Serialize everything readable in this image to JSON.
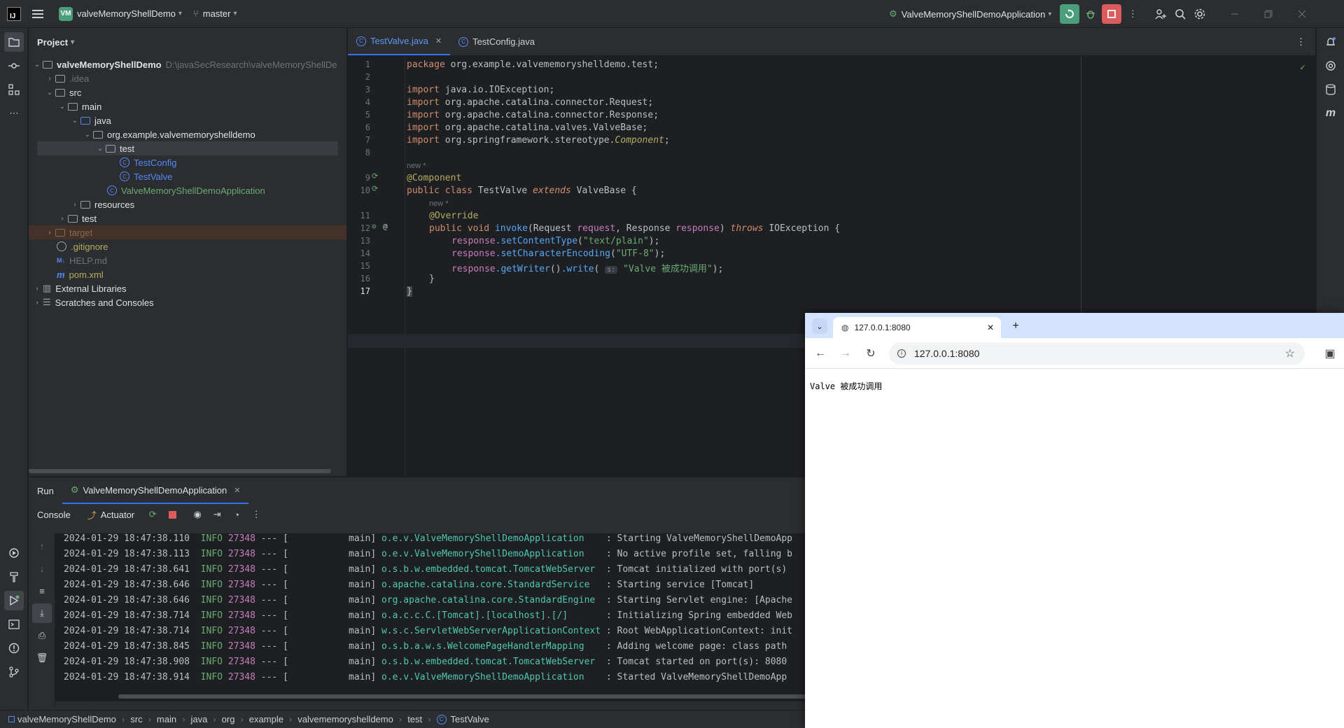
{
  "titlebar": {
    "project_badge": "VM",
    "project_name": "valveMemoryShellDemo",
    "branch": "master",
    "run_config": "ValveMemoryShellDemoApplication"
  },
  "project_panel": {
    "title": "Project",
    "root_name": "valveMemoryShellDemo",
    "root_path": "D:\\javaSecResearch\\valveMemoryShellDe",
    "items": [
      {
        "label": ".idea"
      },
      {
        "label": "src"
      },
      {
        "label": "main"
      },
      {
        "label": "java"
      },
      {
        "label": "org.example.valvememoryshelldemo"
      },
      {
        "label": "test"
      },
      {
        "label": "TestConfig"
      },
      {
        "label": "TestValve"
      },
      {
        "label": "ValveMemoryShellDemoApplication"
      },
      {
        "label": "resources"
      },
      {
        "label": "test"
      },
      {
        "label": "target"
      },
      {
        "label": ".gitignore"
      },
      {
        "label": "HELP.md"
      },
      {
        "label": "pom.xml"
      },
      {
        "label": "External Libraries"
      },
      {
        "label": "Scratches and Consoles"
      }
    ]
  },
  "editor": {
    "tabs": [
      {
        "label": "TestValve.java"
      },
      {
        "label": "TestConfig.java"
      }
    ],
    "line_numbers": [
      "1",
      "2",
      "3",
      "4",
      "5",
      "6",
      "7",
      "8",
      "9",
      "10",
      "11",
      "12",
      "13",
      "14",
      "15",
      "16",
      "17"
    ],
    "code": {
      "l1_kw": "package",
      "l1_rest": " org.example.valvememoryshelldemo.test;",
      "l3_kw": "import",
      "l3_rest": " java.io.IOException;",
      "l4_kw": "import",
      "l4_rest": " org.apache.catalina.connector.Request;",
      "l5_kw": "import",
      "l5_rest": " org.apache.catalina.connector.Response;",
      "l6_kw": "import",
      "l6_rest": " org.apache.catalina.valves.ValveBase;",
      "l7_kw": "import",
      "l7_rest_a": " org.springframework.stereotype.",
      "l7_rest_b": "Component",
      "l7_rest_c": ";",
      "hint_new": "new *",
      "l9": "@Component",
      "l10_public": "public",
      "l10_class": " class ",
      "l10_name": "TestValve ",
      "l10_extends": "extends",
      "l10_base": " ValveBase {",
      "l11": "@Override",
      "l12_public": "public",
      "l12_void": " void ",
      "l12_method": "invoke",
      "l12_params_a": "(Request ",
      "l12_p1": "request",
      "l12_params_b": ", Response ",
      "l12_p2": "response",
      "l12_params_c": ") ",
      "l12_throws": "throws",
      "l12_exc": " IOException {",
      "l13_obj": "response",
      "l13_method": ".setContentType",
      "l13_str": "\"text/plain\"",
      "l14_obj": "response",
      "l14_method": ".setCharacterEncoding",
      "l14_str": "\"UTF-8\"",
      "l15_obj": "response",
      "l15_method": ".getWriter",
      "l15_method2": ".write",
      "l15_inlay": "s:",
      "l15_str": "\"Valve 被成功调用\"",
      "l16": "}",
      "l17": "}"
    }
  },
  "run_panel": {
    "title": "Run",
    "config_tab": "ValveMemoryShellDemoApplication",
    "console_tab": "Console",
    "actuator_tab": "Actuator",
    "log_lines": [
      {
        "ts": "2024-01-29 18:47:38.110",
        "level": "INFO",
        "pid": "27348",
        "sep": "--- [",
        "thread": "           main]",
        "logger": "o.e.v.ValveMemoryShellDemoApplication   ",
        "msg": " : Starting ValveMemoryShellDemoApp"
      },
      {
        "ts": "2024-01-29 18:47:38.113",
        "level": "INFO",
        "pid": "27348",
        "sep": "--- [",
        "thread": "           main]",
        "logger": "o.e.v.ValveMemoryShellDemoApplication   ",
        "msg": " : No active profile set, falling b"
      },
      {
        "ts": "2024-01-29 18:47:38.641",
        "level": "INFO",
        "pid": "27348",
        "sep": "--- [",
        "thread": "           main]",
        "logger": "o.s.b.w.embedded.tomcat.TomcatWebServer ",
        "msg": " : Tomcat initialized with port(s)"
      },
      {
        "ts": "2024-01-29 18:47:38.646",
        "level": "INFO",
        "pid": "27348",
        "sep": "--- [",
        "thread": "           main]",
        "logger": "o.apache.catalina.core.StandardService  ",
        "msg": " : Starting service [Tomcat]"
      },
      {
        "ts": "2024-01-29 18:47:38.646",
        "level": "INFO",
        "pid": "27348",
        "sep": "--- [",
        "thread": "           main]",
        "logger": "org.apache.catalina.core.StandardEngine ",
        "msg": " : Starting Servlet engine: [Apache"
      },
      {
        "ts": "2024-01-29 18:47:38.714",
        "level": "INFO",
        "pid": "27348",
        "sep": "--- [",
        "thread": "           main]",
        "logger": "o.a.c.c.C.[Tomcat].[localhost].[/]      ",
        "msg": " : Initializing Spring embedded Web"
      },
      {
        "ts": "2024-01-29 18:47:38.714",
        "level": "INFO",
        "pid": "27348",
        "sep": "--- [",
        "thread": "           main]",
        "logger": "w.s.c.ServletWebServerApplicationContext",
        "msg": " : Root WebApplicationContext: init"
      },
      {
        "ts": "2024-01-29 18:47:38.845",
        "level": "INFO",
        "pid": "27348",
        "sep": "--- [",
        "thread": "           main]",
        "logger": "o.s.b.a.w.s.WelcomePageHandlerMapping   ",
        "msg": " : Adding welcome page: class path"
      },
      {
        "ts": "2024-01-29 18:47:38.908",
        "level": "INFO",
        "pid": "27348",
        "sep": "--- [",
        "thread": "           main]",
        "logger": "o.s.b.w.embedded.tomcat.TomcatWebServer ",
        "msg": " : Tomcat started on port(s): 8080"
      },
      {
        "ts": "2024-01-29 18:47:38.914",
        "level": "INFO",
        "pid": "27348",
        "sep": "--- [",
        "thread": "           main]",
        "logger": "o.e.v.ValveMemoryShellDemoApplication   ",
        "msg": " : Started ValveMemoryShellDemoApp"
      }
    ]
  },
  "statusbar": {
    "crumbs": [
      "valveMemoryShellDemo",
      "src",
      "main",
      "java",
      "org",
      "example",
      "valvememoryshelldemo",
      "test",
      "TestValve"
    ]
  },
  "browser": {
    "tab_title": "127.0.0.1:8080",
    "url": "127.0.0.1:8080",
    "page_text": "Valve 被成功调用"
  },
  "colors": {
    "accent": "#3574f0",
    "run_green": "#4a9e7b",
    "stop_red": "#db5c5c",
    "browser_tabstrip": "#d3e3fd"
  }
}
